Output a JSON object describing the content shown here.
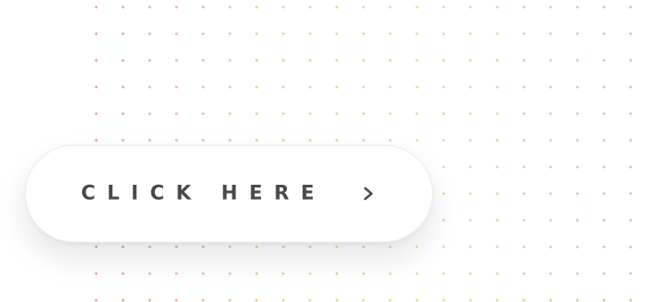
{
  "cta_button": {
    "label": "CLICK HERE",
    "icon": "chevron-right-icon",
    "text_color": "#4a4a4a",
    "background": "#ffffff"
  },
  "background_pattern": {
    "type": "dot-grid",
    "gradient_colors": [
      "#e8957a",
      "#f1c27d",
      "#e6d48a",
      "#9fd07c"
    ]
  }
}
